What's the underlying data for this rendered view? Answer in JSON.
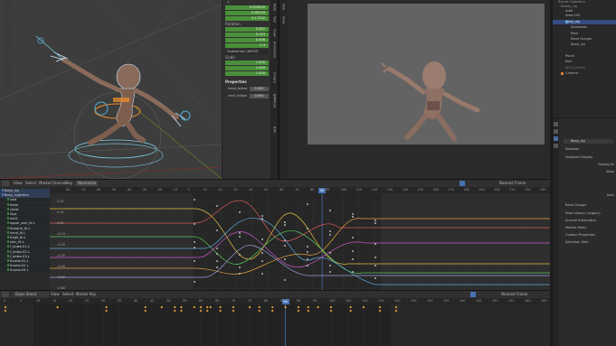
{
  "viewport": {
    "units_label": "m",
    "transform": {
      "location_values": [
        "0.000000",
        "0.06126",
        "0.17332"
      ],
      "rotation_label": "Rotation",
      "rotation_values": [
        "0.922",
        "0.123",
        "0.006",
        "0.3"
      ],
      "rotation_mode": "Quaternion (WXYZ)",
      "scale_label": "Scale",
      "scale_values": [
        "1.000",
        "1.000",
        "1.000"
      ]
    },
    "properties": {
      "header": "Properties",
      "items": [
        {
          "label": "head_follow",
          "value": "0.000"
        },
        {
          "label": "neck_follow",
          "value": "0.000"
        }
      ]
    },
    "side_tabs": [
      "Item",
      "Tool",
      "View",
      "Animation",
      "Create",
      "BIMTools",
      "Edit"
    ]
  },
  "render_panel": {
    "side_tabs": [
      "Tool",
      "View"
    ]
  },
  "outliner": {
    "items": [
      {
        "label": "Scene Collection",
        "indent": 0
      },
      {
        "label": "Boney_rig",
        "indent": 1
      },
      {
        "label": "Area",
        "indent": 2
      },
      {
        "label": "Area.003",
        "indent": 2
      },
      {
        "label": "Bony_rig",
        "indent": 2
      },
      {
        "label": "Animation",
        "indent": 3
      },
      {
        "label": "Pose",
        "indent": 3
      },
      {
        "label": "Bone Groups",
        "indent": 3
      },
      {
        "label": "Bony_rig",
        "indent": 3
      },
      {
        "label": "Plane",
        "indent": 2
      },
      {
        "label": "Rod",
        "indent": 2
      },
      {
        "label": "WGS_Parent",
        "indent": 2
      },
      {
        "label": "Camera",
        "indent": 1
      }
    ]
  },
  "properties_editor": {
    "object_name": "Bony_rig",
    "panels": [
      {
        "label": "Skeleton"
      },
      {
        "label": "Viewport Display"
      },
      {
        "label": "Bone Groups"
      },
      {
        "label": "Pose Library (Legacy)"
      },
      {
        "label": "Inverse Kinematics"
      },
      {
        "label": "Motion Paths"
      },
      {
        "label": "Custom Properties"
      },
      {
        "label": "Selection Sets"
      }
    ],
    "display_labels": [
      "Display As",
      "Show",
      "Axes"
    ]
  },
  "graph_editor": {
    "menu": [
      "View",
      "Select",
      "Marker",
      "Channel",
      "Key"
    ],
    "normalize": "Normalize",
    "snap": "Nearest Frame",
    "frame_ticks": [
      "-80",
      "-70",
      "-60",
      "-50",
      "-40",
      "-30",
      "-20",
      "-10",
      "0",
      "10",
      "20",
      "30",
      "40",
      "50",
      "60",
      "70",
      "80",
      "90",
      "100",
      "110",
      "120",
      "130",
      "140",
      "150",
      "160",
      "170",
      "180",
      "190",
      "200",
      "210",
      "220",
      "230"
    ],
    "current_frame": "86",
    "value_ticks": [
      "0.20",
      "0.10",
      "0.00",
      "-0.10",
      "-0.20",
      "-0.30",
      "-0.40",
      "-0.50",
      "-0.60"
    ],
    "channels": [
      "Bony_rig",
      "Bony_rigAction",
      "root",
      "torso",
      "chest",
      "hips",
      "neck",
      "upper_arm_fk.L",
      "forearm_fk.L",
      "hand_fk.L",
      "thigh_fk.L",
      "shin_fk.L",
      "f_index.01.L",
      "f_index.02.L",
      "f_index.03.L",
      "thumb.01.L",
      "thumb.02.L",
      "thumb.03.L"
    ]
  },
  "dope_sheet": {
    "mode": "Dope Sheet",
    "menu": [
      "View",
      "Select",
      "Marker",
      "Key"
    ],
    "snap": "Nearest Frame",
    "frame_ticks": [
      "0",
      "5",
      "10",
      "15",
      "20",
      "25",
      "30",
      "35",
      "40",
      "45",
      "50",
      "55",
      "60",
      "65",
      "70",
      "75",
      "80",
      "85",
      "90",
      "95",
      "100",
      "105",
      "110",
      "115",
      "120",
      "125",
      "130",
      "135",
      "140",
      "145",
      "150",
      "155",
      "160",
      "165"
    ],
    "current_frame": "86"
  }
}
